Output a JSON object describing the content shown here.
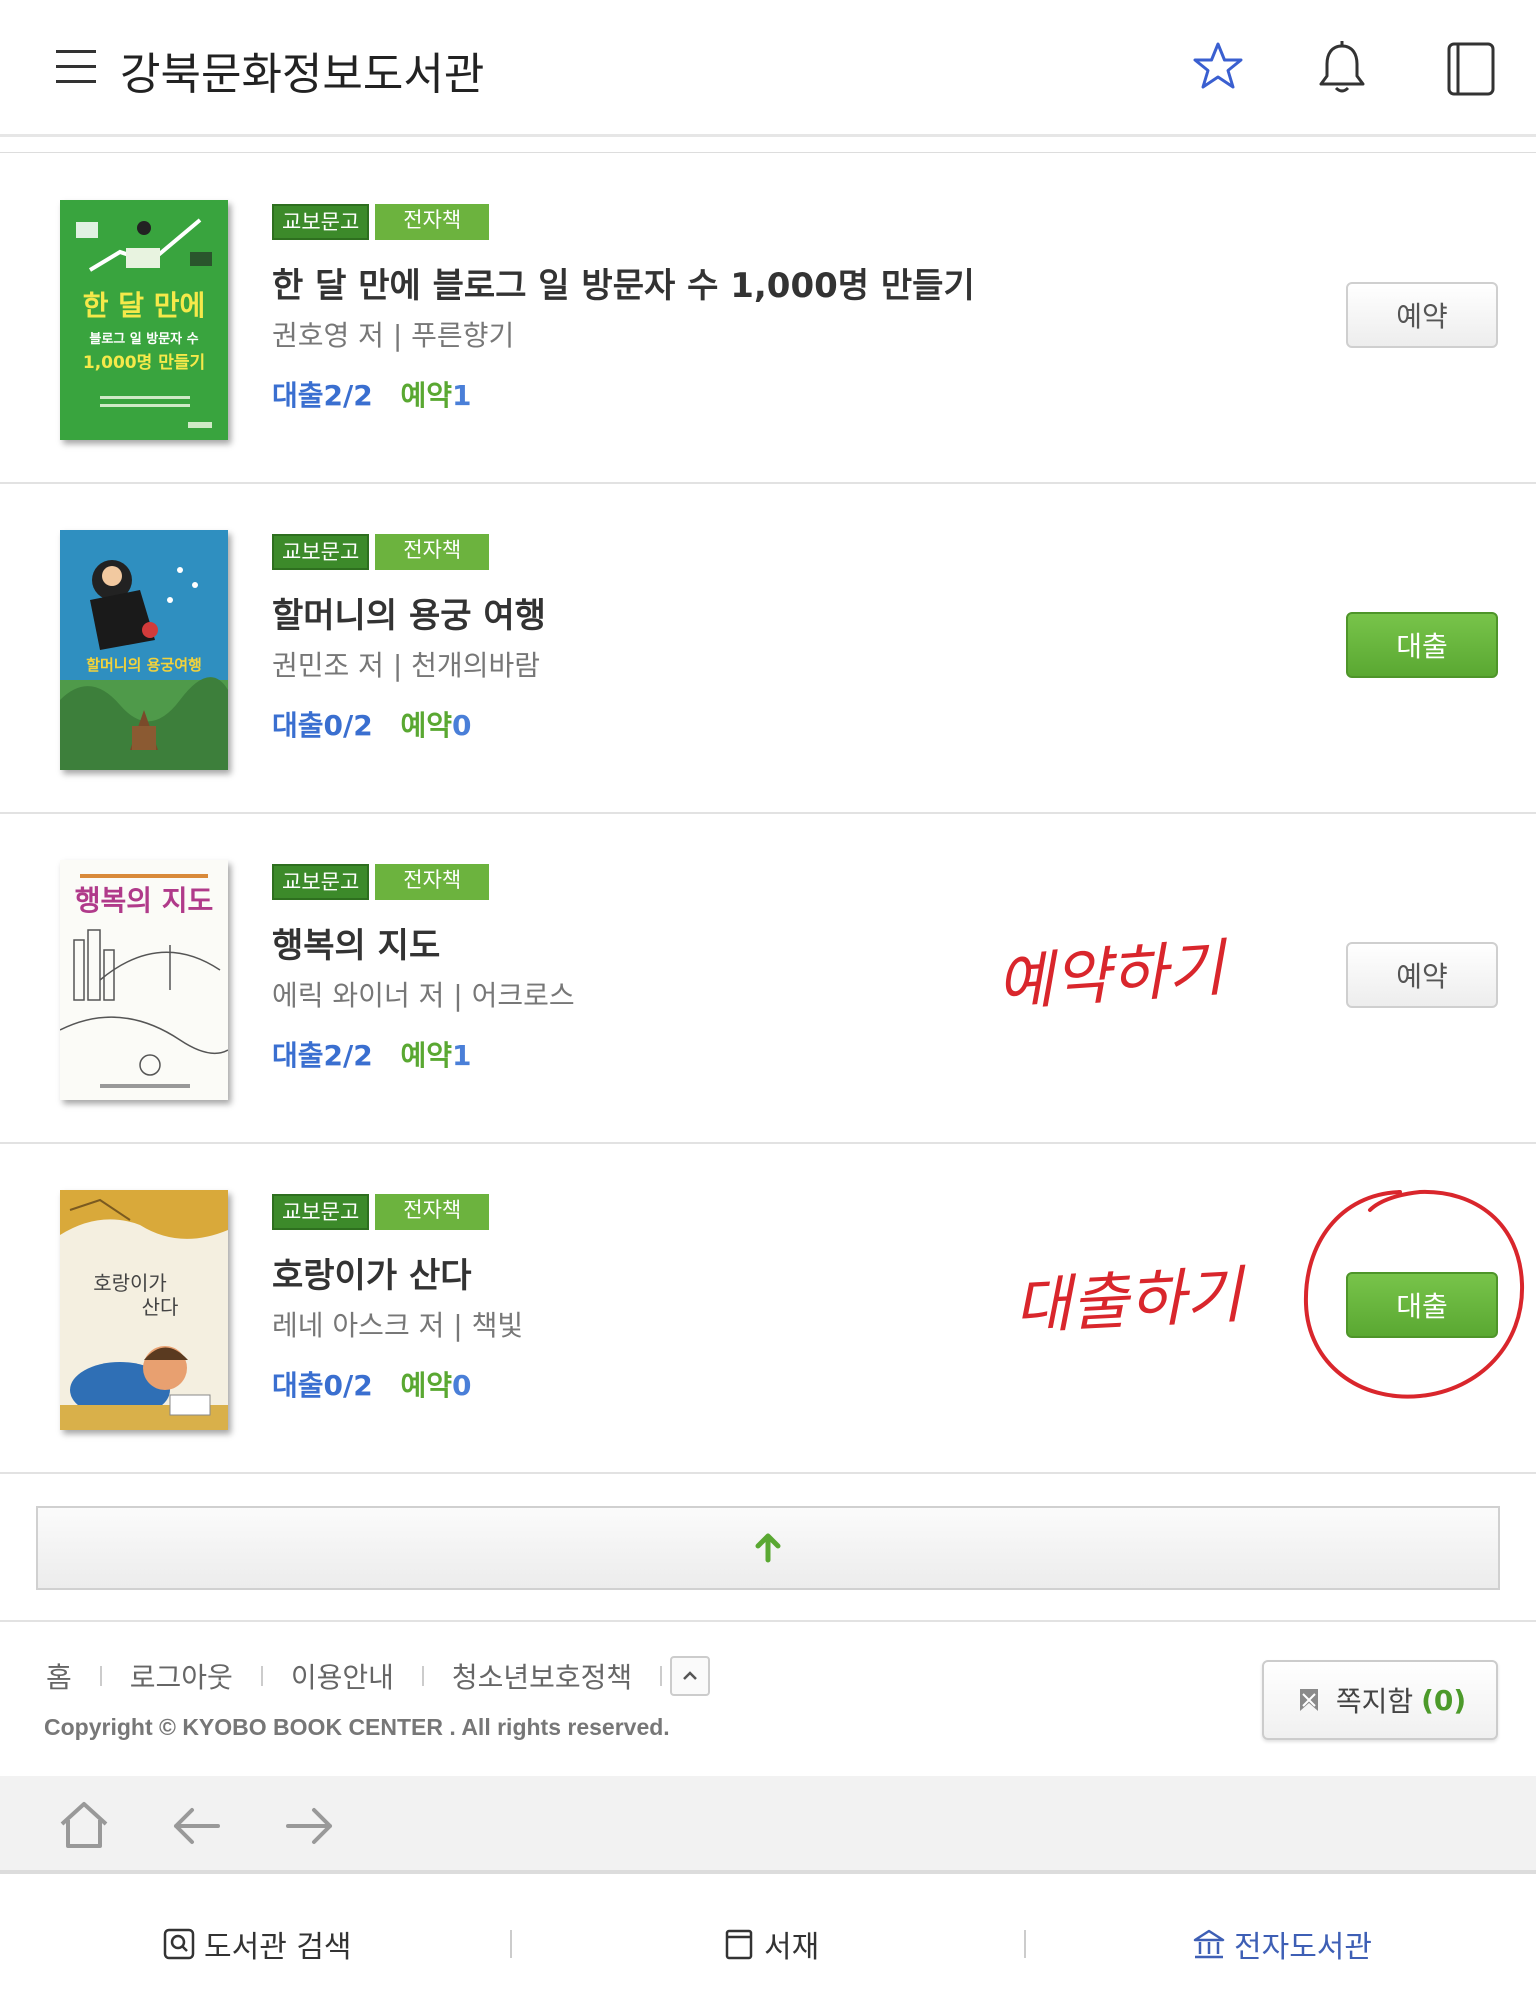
{
  "header": {
    "title": "강북문화정보도서관",
    "icons": [
      "menu-icon",
      "star-icon",
      "bell-icon",
      "book-icon"
    ]
  },
  "books": [
    {
      "badge_publisher": "교보문고",
      "badge_type": "전자책",
      "title": "한 달 만에 블로그 일 방문자 수 1,000명 만들기",
      "meta": "권호영 저 | 푸른향기",
      "loan_label": "대출",
      "loan_value": "2/2",
      "reserve_label": "예약",
      "reserve_value": "1",
      "button": "예약",
      "cover_text": [
        "한 달 만에",
        "블로그 일 방문자 수",
        "1,000명 만들기"
      ]
    },
    {
      "badge_publisher": "교보문고",
      "badge_type": "전자책",
      "title": "할머니의 용궁 여행",
      "meta": "권민조 저 | 천개의바람",
      "loan_label": "대출",
      "loan_value": "0/2",
      "reserve_label": "예약",
      "reserve_value": "0",
      "button": "대출"
    },
    {
      "badge_publisher": "교보문고",
      "badge_type": "전자책",
      "title": "행복의 지도",
      "meta": "에릭 와이너 저 | 어크로스",
      "loan_label": "대출",
      "loan_value": "2/2",
      "reserve_label": "예약",
      "reserve_value": "1",
      "button": "예약",
      "cover_text": [
        "행복의 지도"
      ]
    },
    {
      "badge_publisher": "교보문고",
      "badge_type": "전자책",
      "title": "호랑이가 산다",
      "meta": "레네 아스크 저 | 책빛",
      "loan_label": "대출",
      "loan_value": "0/2",
      "reserve_label": "예약",
      "reserve_value": "0",
      "button": "대출",
      "cover_text": [
        "호랑이가",
        "산다"
      ]
    }
  ],
  "annotations": {
    "reserve_note": "예약하기",
    "loan_note": "대출하기",
    "color": "#d9262c"
  },
  "footer": {
    "links": [
      "홈",
      "로그아웃",
      "이용안내",
      "청소년보호정책"
    ],
    "copyright": "Copyright © KYOBO BOOK CENTER . All rights reserved.",
    "message_box_label": "쪽지함",
    "message_box_count": "(0)"
  },
  "tabs": [
    {
      "label": "도서관 검색",
      "icon": "search-icon"
    },
    {
      "label": "서재",
      "icon": "bookshelf-icon"
    },
    {
      "label": "전자도서관",
      "icon": "library-icon",
      "active": true
    }
  ],
  "colors": {
    "accent_green": "#5aa832",
    "loan_blue": "#3a6fd0",
    "active_tab": "#3e5fb5"
  }
}
